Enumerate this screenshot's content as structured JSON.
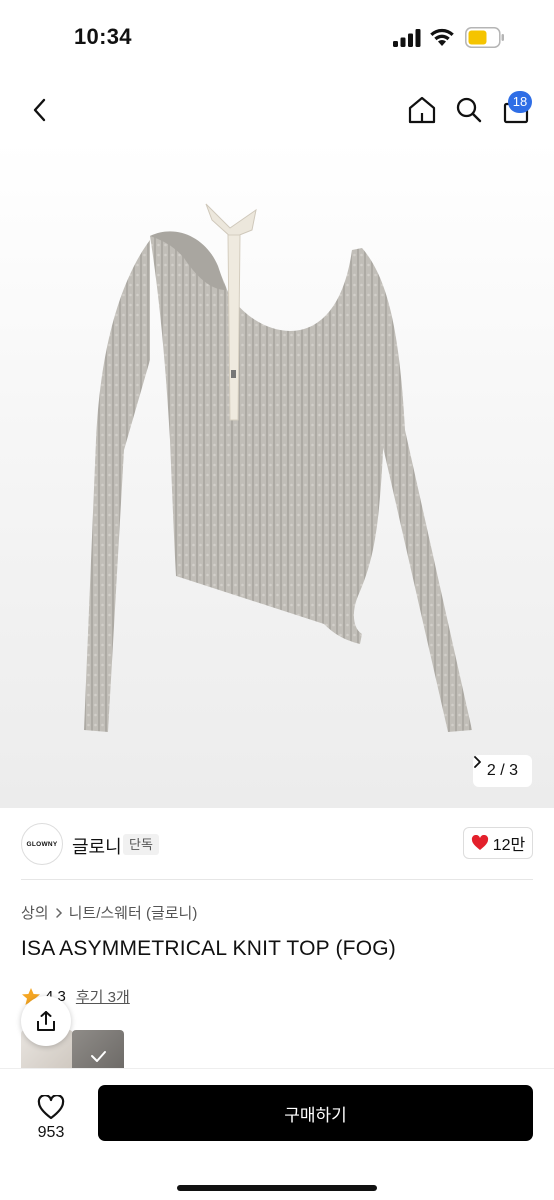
{
  "status_bar": {
    "time": "10:34"
  },
  "header": {
    "cart_count": "18",
    "icons": [
      "back-icon",
      "home-icon",
      "search-icon",
      "cart-icon"
    ]
  },
  "gallery": {
    "current": "2",
    "separator": "/",
    "total": "3"
  },
  "brand": {
    "logo_text": "GLOWNY",
    "name": "글로니",
    "tag": "단독",
    "likes": "12만"
  },
  "breadcrumb": {
    "category": "상의",
    "subcategory": "니트/스웨터 (글로니)"
  },
  "product": {
    "title": "ISA ASYMMETRICAL KNIT TOP (FOG)"
  },
  "rating": {
    "score": "4.3",
    "reviews": "후기 3개"
  },
  "bottom_bar": {
    "wish_count": "953",
    "buy_label": "구매하기"
  },
  "colors": {
    "accent": "#2f6ee6",
    "heart": "#e3202b",
    "star": "#f5a623",
    "knit": "#bdbab4",
    "primary_button": "#000000"
  }
}
